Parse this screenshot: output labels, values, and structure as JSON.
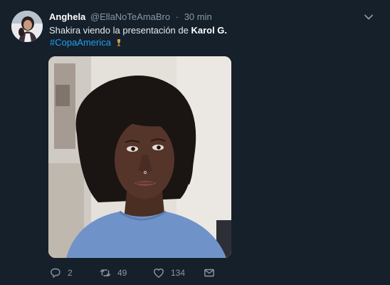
{
  "tweet": {
    "display_name": "Anghela",
    "handle": "@EllaNoTeAmaBro",
    "separator": "·",
    "time": "30 min",
    "text_plain": "Shakira viendo la presentación de ",
    "text_bold": "Karol G.",
    "hashtag": "#CopaAmerica"
  },
  "actions": {
    "replies": "2",
    "retweets": "49",
    "likes": "134"
  },
  "icons": {
    "avatar": "avatar",
    "more": "chevron-down-icon",
    "trophy": "trophy-icon",
    "reply": "reply-icon",
    "retweet": "retweet-icon",
    "like": "heart-icon",
    "dm": "envelope-icon"
  },
  "colors": {
    "background": "#15202b",
    "link": "#1da1f2",
    "muted": "#8899a6",
    "text": "#e6ecf0"
  }
}
